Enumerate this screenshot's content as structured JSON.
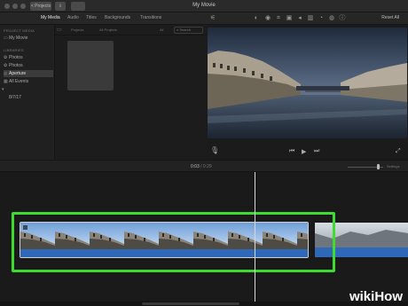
{
  "window": {
    "title": "My Movie",
    "back_button": "< Projects"
  },
  "toolbar": {
    "tabs": [
      "My Media",
      "Audio",
      "Titles",
      "Backgrounds",
      "Transitions"
    ],
    "active_tab": "My Media",
    "reset_all": "Reset All"
  },
  "sidebar": {
    "project_header": "PROJECT MEDIA",
    "project_item": "My Movie",
    "libraries_header": "LIBRARIES",
    "items": [
      "Photos",
      "Photos",
      "Aperture",
      "All Events"
    ],
    "selected_item": "Aperture",
    "date_label": "8/7/17"
  },
  "browser": {
    "filter_label": "Projects",
    "all_projects_label": "All Projects",
    "count_label": "All",
    "search_placeholder": "Search"
  },
  "timeline": {
    "current_time": "0:03",
    "total_time": "0:29",
    "settings_label": "Settings"
  },
  "watermark": {
    "wiki": "wiki",
    "how": "How"
  },
  "colors": {
    "highlight": "#3ddc2f",
    "sky": "#8fb3e0",
    "water": "#3a6fc0"
  }
}
